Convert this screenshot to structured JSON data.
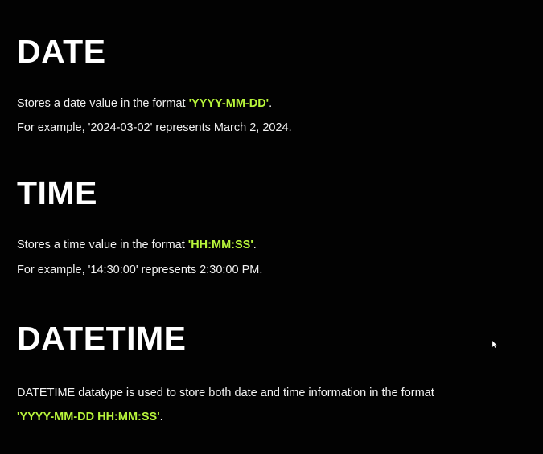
{
  "sections": {
    "date": {
      "heading": "DATE",
      "line1_prefix": "Stores a date value in the format ",
      "line1_format": "'YYYY-MM-DD'",
      "line1_suffix": ".",
      "line2": "For example, '2024-03-02' represents March 2, 2024."
    },
    "time": {
      "heading": "TIME",
      "line1_prefix": "Stores a time value in the format ",
      "line1_format": "'HH:MM:SS'",
      "line1_suffix": ".",
      "line2": "For example, '14:30:00' represents 2:30:00 PM."
    },
    "datetime": {
      "heading": "DATETIME",
      "line1": "DATETIME datatype is used to store both date and time information in the format",
      "line2_format": "'YYYY-MM-DD HH:MM:SS'",
      "line2_suffix": "."
    }
  },
  "colors": {
    "background": "#000000",
    "text": "#ffffff",
    "highlight": "#b8f53b"
  },
  "icons": {
    "cursor": "mouse-pointer-icon"
  }
}
